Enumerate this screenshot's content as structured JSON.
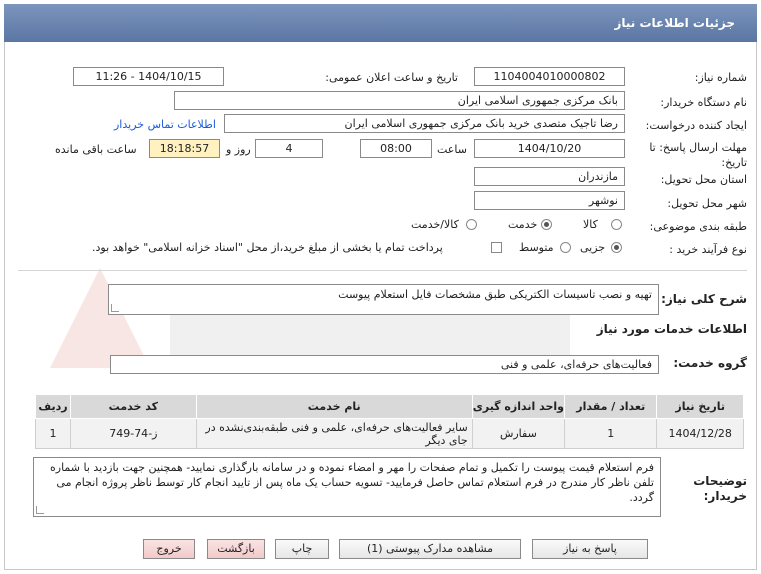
{
  "header": {
    "title": "جزئیات اطلاعات نیاز"
  },
  "need_number": {
    "label": "شماره نیاز:",
    "value": "1104004010000802"
  },
  "announce_datetime": {
    "label": "تاریخ و ساعت اعلان عمومی:",
    "value": "1404/10/15 - 11:26"
  },
  "buyer_org": {
    "label": "نام دستگاه خریدار:",
    "value": "بانک مرکزی جمهوری اسلامی ایران"
  },
  "requester": {
    "label": "ایجاد کننده درخواست:",
    "value": "رضا تاجیک متصدی خرید بانک مرکزی جمهوری اسلامی ایران",
    "contact_link": "اطلاعات تماس خریدار"
  },
  "deadline": {
    "label": "مهلت ارسال پاسخ: تا تاریخ:",
    "date": "1404/10/20",
    "time_label": "ساعت",
    "time": "08:00",
    "days": "4",
    "days_label": "روز و",
    "remaining": "18:18:57",
    "remaining_label": "ساعت باقی مانده"
  },
  "province": {
    "label": "استان محل تحویل:",
    "value": "مازندران"
  },
  "city": {
    "label": "شهر محل تحویل:",
    "value": "نوشهر"
  },
  "category": {
    "label": "طبقه بندی موضوعی:",
    "options": [
      "کالا",
      "خدمت",
      "کالا/خدمت"
    ],
    "selected": 1
  },
  "purchase_type": {
    "label": "نوع فرآیند خرید :",
    "options": [
      "جزیی",
      "متوسط"
    ],
    "selected": 0,
    "note": "پرداخت تمام یا بخشی از مبلغ خرید،از محل \"اسناد خزانه اسلامی\" خواهد بود."
  },
  "summary": {
    "label": "شرح کلی نیاز:",
    "value": "تهیه و نصب تاسیسات الکتریکی طبق مشخصات فایل استعلام پیوست"
  },
  "services_section": {
    "title": "اطلاعات خدمات مورد نیاز"
  },
  "service_group": {
    "label": "گروه خدمت:",
    "value": "فعالیت‌های حرفه‌ای، علمی و فنی"
  },
  "table": {
    "headers": [
      "ردیف",
      "کد خدمت",
      "نام خدمت",
      "واحد اندازه گیری",
      "تعداد / مقدار",
      "تاریخ نیاز"
    ],
    "rows": [
      [
        "1",
        "ز-74-749",
        "سایر فعالیت‌های حرفه‌ای، علمی و فنی طبقه‌بندی‌نشده در جای دیگر",
        "سفارش",
        "1",
        "1404/12/28"
      ]
    ]
  },
  "buyer_notes": {
    "label": "توضیحات خریدار:",
    "value": "فرم استعلام قیمت پیوست را تکمیل و تمام صفحات را مهر و امضاء نموده و در سامانه بارگذاری نمایید- همچنین جهت بازدید با شماره تلفن ناظر کار مندرج در فرم استعلام تماس حاصل فرمایید- تسویه حساب یک ماه پس از تایید انجام کار توسط ناظر پروژه انجام می گردد."
  },
  "buttons": {
    "reply": "پاسخ به نیاز",
    "attachments": "مشاهده مدارک پیوستی (1)",
    "print": "چاپ",
    "back": "بازگشت",
    "exit": "خروج"
  },
  "colors": {
    "header_bg": "#6a85b0",
    "link": "#1a5cd6",
    "highlight": "#fff2c0"
  }
}
